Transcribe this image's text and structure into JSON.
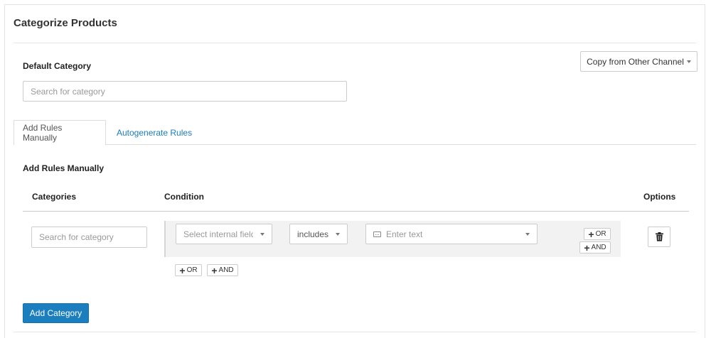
{
  "panel": {
    "title": "Categorize Products"
  },
  "default_category": {
    "label": "Default Category",
    "search_placeholder": "Search for category",
    "copy_button_label": "Copy from Other Channel"
  },
  "tabs": [
    {
      "label": "Add Rules Manually",
      "active": true
    },
    {
      "label": "Autogenerate Rules",
      "active": false
    }
  ],
  "rules": {
    "section_title": "Add Rules Manually",
    "columns": {
      "categories": "Categories",
      "condition": "Condition",
      "options": "Options"
    },
    "row": {
      "category_placeholder": "Search for category",
      "field_select_placeholder": "Select internal field",
      "operator_value": "includes",
      "text_placeholder": "Enter text",
      "or_label": "OR",
      "and_label": "AND"
    },
    "group_or_label": "OR",
    "group_and_label": "AND"
  },
  "actions": {
    "add_category_label": "Add Category"
  },
  "colors": {
    "primary": "#1b7fbf",
    "link": "#1a7cba",
    "condition_bg": "#f2f2f2"
  },
  "icons": {
    "delete": "trash-icon",
    "keyboard": "keyboard-icon",
    "add": "plus-icon",
    "dropdown": "caret-down-icon"
  }
}
